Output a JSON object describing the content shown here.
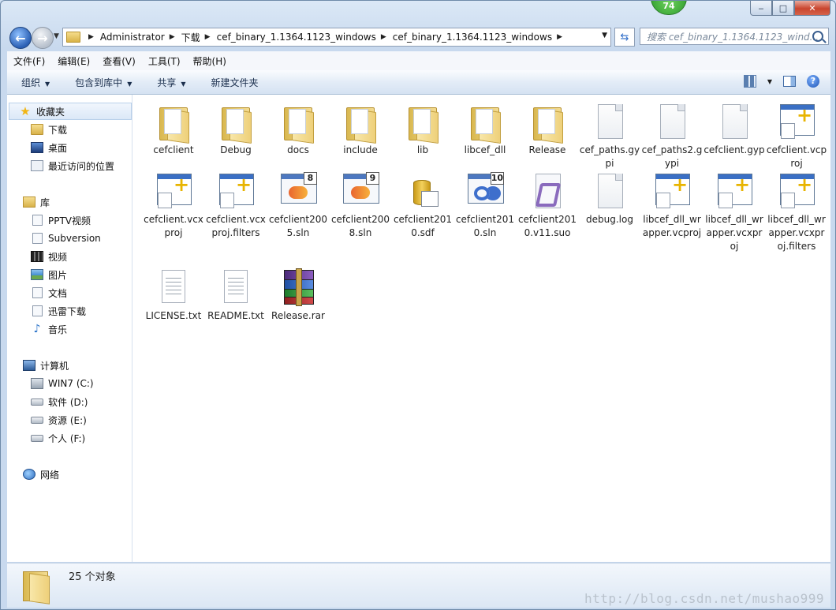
{
  "taskbar_badge": "74",
  "window": {
    "minimize_label": "‒",
    "maximize_label": "□",
    "close_label": "✕"
  },
  "address": {
    "breadcrumbs": [
      "Administrator",
      "下载",
      "cef_binary_1.1364.1123_windows",
      "cef_binary_1.1364.1123_windows"
    ],
    "search_placeholder": "搜索 cef_binary_1.1364.1123_wind..."
  },
  "menubar": [
    "文件(F)",
    "编辑(E)",
    "查看(V)",
    "工具(T)",
    "帮助(H)"
  ],
  "toolbar": {
    "organize": "组织",
    "include_in_library": "包含到库中",
    "share": "共享",
    "new_folder": "新建文件夹"
  },
  "navpane": {
    "favorites": "收藏夹",
    "downloads": "下载",
    "desktop": "桌面",
    "recent": "最近访问的位置",
    "libraries": "库",
    "pptv": "PPTV视频",
    "subversion": "Subversion",
    "videos": "视频",
    "pictures": "图片",
    "documents": "文档",
    "xunlei": "迅雷下载",
    "music": "音乐",
    "computer": "计算机",
    "drive_c": "WIN7 (C:)",
    "drive_d": "软件 (D:)",
    "drive_e": "资源 (E:)",
    "drive_f": "个人 (F:)",
    "network": "网络"
  },
  "files": [
    {
      "name": "cefclient",
      "icon": "folder-icon"
    },
    {
      "name": "Debug",
      "icon": "folder-icon"
    },
    {
      "name": "docs",
      "icon": "folder-icon"
    },
    {
      "name": "include",
      "icon": "folder-icon"
    },
    {
      "name": "lib",
      "icon": "folder-icon"
    },
    {
      "name": "libcef_dll",
      "icon": "folder-icon"
    },
    {
      "name": "Release",
      "icon": "folder-icon"
    },
    {
      "name": "cef_paths.gypi",
      "icon": "blank-file-icon"
    },
    {
      "name": "cef_paths2.gypi",
      "icon": "blank-file-icon"
    },
    {
      "name": "cefclient.gyp",
      "icon": "blank-file-icon"
    },
    {
      "name": "cefclient.vcproj",
      "icon": "vcproj-icon"
    },
    {
      "name": "cefclient.vcxproj",
      "icon": "vcxproj-icon"
    },
    {
      "name": "cefclient.vcxproj.filters",
      "icon": "vcxproj-icon"
    },
    {
      "name": "cefclient2005.sln",
      "icon": "solution-icon",
      "version": "8"
    },
    {
      "name": "cefclient2008.sln",
      "icon": "solution-icon",
      "version": "9"
    },
    {
      "name": "cefclient2010.sdf",
      "icon": "database-icon"
    },
    {
      "name": "cefclient2010.sln",
      "icon": "solution-icon",
      "version": "10"
    },
    {
      "name": "cefclient2010.v11.suo",
      "icon": "suo-icon"
    },
    {
      "name": "debug.log",
      "icon": "blank-file-icon"
    },
    {
      "name": "libcef_dll_wrapper.vcproj",
      "icon": "vcproj-icon"
    },
    {
      "name": "libcef_dll_wrapper.vcxproj",
      "icon": "vcxproj-icon"
    },
    {
      "name": "libcef_dll_wrapper.vcxproj.filters",
      "icon": "vcxproj-icon"
    },
    {
      "name": "LICENSE.txt",
      "icon": "text-file-icon"
    },
    {
      "name": "README.txt",
      "icon": "text-file-icon"
    },
    {
      "name": "Release.rar",
      "icon": "rar-archive-icon"
    }
  ],
  "status": {
    "count_text": "25 个对象"
  },
  "watermark": "http://blog.csdn.net/mushao999"
}
